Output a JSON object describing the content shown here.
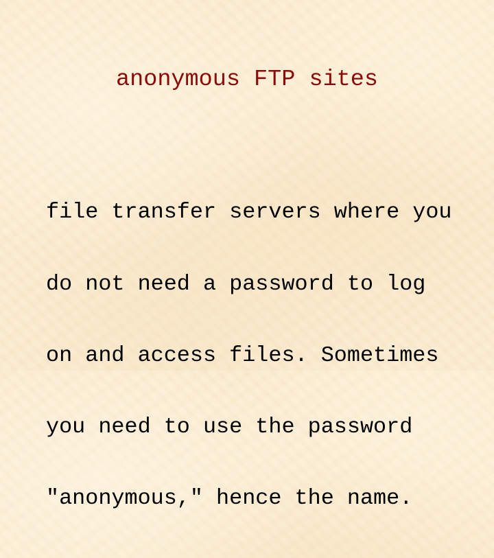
{
  "slide": {
    "title": "anonymous FTP sites",
    "body_lines": [
      "file transfer servers where you",
      "do not need a password to log",
      "on and access files. Sometimes",
      "you need to use the password",
      "\"anonymous,\" hence the name."
    ],
    "colors": {
      "background": "#fbebd0",
      "title": "#8b0a0a",
      "body": "#000000"
    }
  }
}
